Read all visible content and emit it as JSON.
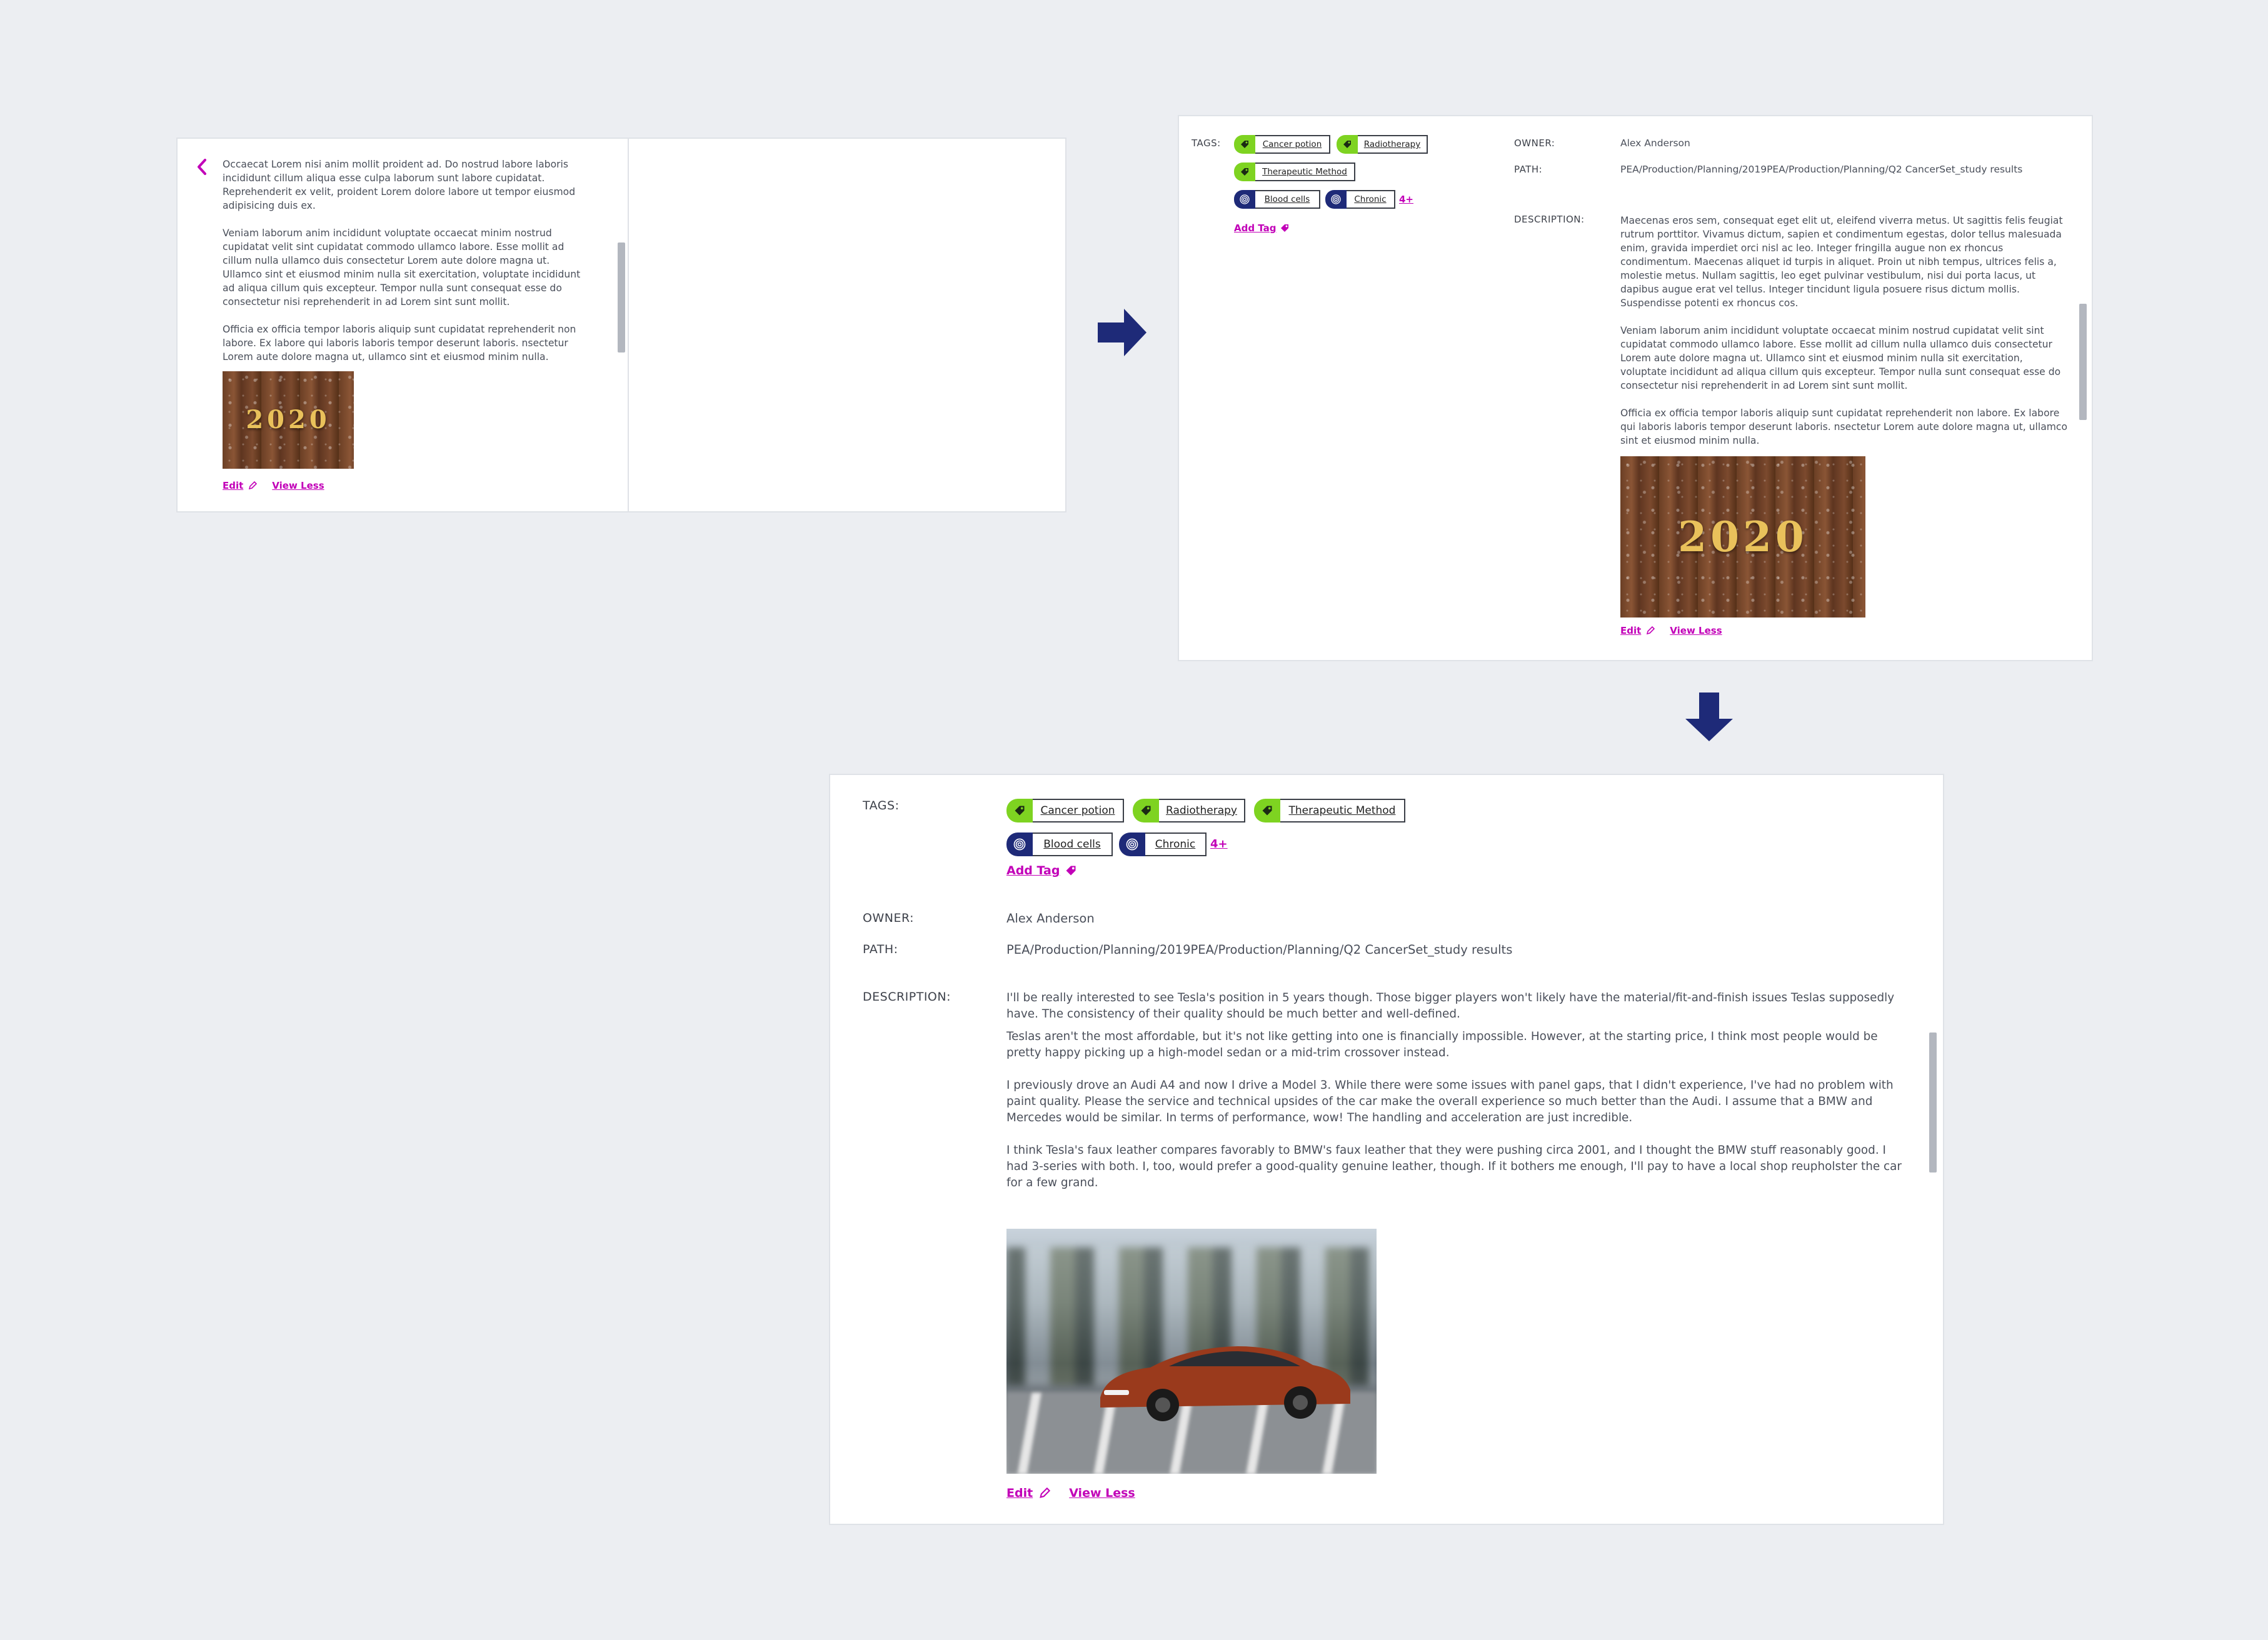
{
  "step1": {
    "paragraphs": [
      "Occaecat Lorem nisi anim mollit proident ad. Do nostrud labore laboris incididunt cillum aliqua esse culpa laborum sunt labore cupidatat. Reprehenderit ex velit, proident Lorem dolore labore ut tempor eiusmod adipisicing duis ex.",
      "Veniam laborum anim incididunt voluptate occaecat minim nostrud cupidatat velit sint cupidatat commodo ullamco labore. Esse mollit ad cillum nulla ullamco duis consectetur Lorem aute dolore magna ut. Ullamco sint et eiusmod minim nulla sit exercitation, voluptate incididunt ad aliqua cillum quis excepteur. Tempor nulla sunt consequat esse do consectetur nisi reprehenderit in ad Lorem sint sunt mollit.",
      "Officia ex officia tempor laboris aliquip sunt cupidatat reprehenderit non labore. Ex labore qui laboris laboris tempor deserunt laboris. nsectetur Lorem aute dolore magna ut, ullamco sint et eiusmod minim nulla."
    ],
    "image_text": "2020",
    "edit_label": "Edit",
    "view_less_label": "View Less"
  },
  "step2": {
    "tags_label": "TAGS:",
    "tags_green": [
      "Cancer potion",
      "Radiotherapy",
      "Therapeutic Method"
    ],
    "tags_navy": [
      "Blood cells",
      "Chronic"
    ],
    "more_label": "4+",
    "add_tag_label": "Add Tag",
    "owner_label": "OWNER:",
    "owner_value": "Alex Anderson",
    "path_label": "PATH:",
    "path_value": "PEA/Production/Planning/2019PEA/Production/Planning/Q2 CancerSet_study results",
    "description_label": "DESCRIPTION:",
    "paragraphs": [
      "Maecenas eros sem, consequat eget elit ut, eleifend viverra metus. Ut sagittis felis feugiat rutrum porttitor. Vivamus dictum, sapien et condimentum egestas, dolor tellus malesuada enim, gravida imperdiet orci nisl ac leo. Integer fringilla augue non ex rhoncus condimentum. Maecenas aliquet id turpis in aliquet. Proin ut nibh tempus, ultrices felis a, molestie metus. Nullam sagittis, leo eget pulvinar vestibulum, nisi dui porta lacus, ut dapibus augue erat vel tellus. Integer tincidunt ligula posuere risus dictum mollis. Suspendisse potenti ex rhoncus cos.",
      "Veniam laborum anim incididunt voluptate occaecat minim nostrud cupidatat velit sint cupidatat commodo ullamco labore. Esse mollit ad cillum nulla ullamco duis consectetur Lorem aute dolore magna ut. Ullamco sint et eiusmod minim nulla sit exercitation, voluptate incididunt ad aliqua cillum quis excepteur. Tempor nulla sunt consequat esse do consectetur nisi reprehenderit in ad Lorem sint sunt mollit.",
      "Officia ex officia tempor laboris aliquip sunt cupidatat reprehenderit non labore. Ex labore qui laboris laboris tempor deserunt laboris. nsectetur Lorem aute dolore magna ut, ullamco sint et eiusmod minim nulla."
    ],
    "image_text": "2020",
    "edit_label": "Edit",
    "view_less_label": "View Less"
  },
  "step3": {
    "tags_label": "TAGS:",
    "tags_green": [
      "Cancer potion",
      "Radiotherapy",
      "Therapeutic Method"
    ],
    "tags_navy": [
      "Blood cells",
      "Chronic"
    ],
    "more_label": "4+",
    "add_tag_label": "Add Tag",
    "owner_label": "OWNER:",
    "owner_value": "Alex Anderson",
    "path_label": "PATH:",
    "path_value": "PEA/Production/Planning/2019PEA/Production/Planning/Q2 CancerSet_study results",
    "description_label": "DESCRIPTION:",
    "paragraphs": [
      "I'll be really interested to see Tesla's position in 5 years though. Those bigger players won't likely have the material/fit-and-finish issues Teslas supposedly have. The consistency of their quality should be much better and well-defined.",
      "Teslas aren't the most affordable, but it's not like getting into one is financially impossible. However, at the starting price, I think most people would be pretty happy picking up a high-model sedan or a mid-trim crossover instead.",
      " I previously drove an Audi A4 and now I drive a Model 3. While there were some issues with panel gaps, that I didn't experience, I've had no problem with paint quality. Please the service and technical upsides of the car make the overall experience so much better than the Audi. I assume that a BMW and Mercedes would be similar. In terms of performance, wow! The handling and acceleration are just incredible.",
      "I think Tesla's faux leather compares favorably to BMW's faux leather that they were pushing circa 2001, and I thought the BMW stuff reasonably good. I had 3-series with both. I, too, would prefer a good-quality genuine leather, though. If it bothers me enough, I'll pay to have a local shop reupholster the car for a few grand."
    ],
    "edit_label": "Edit",
    "view_less_label": "View Less"
  },
  "colors": {
    "accent": "#c200b8",
    "arrow": "#1e2a78",
    "tag_green": "#7ed321",
    "tag_navy": "#1e2a78",
    "background": "#eceef2"
  }
}
